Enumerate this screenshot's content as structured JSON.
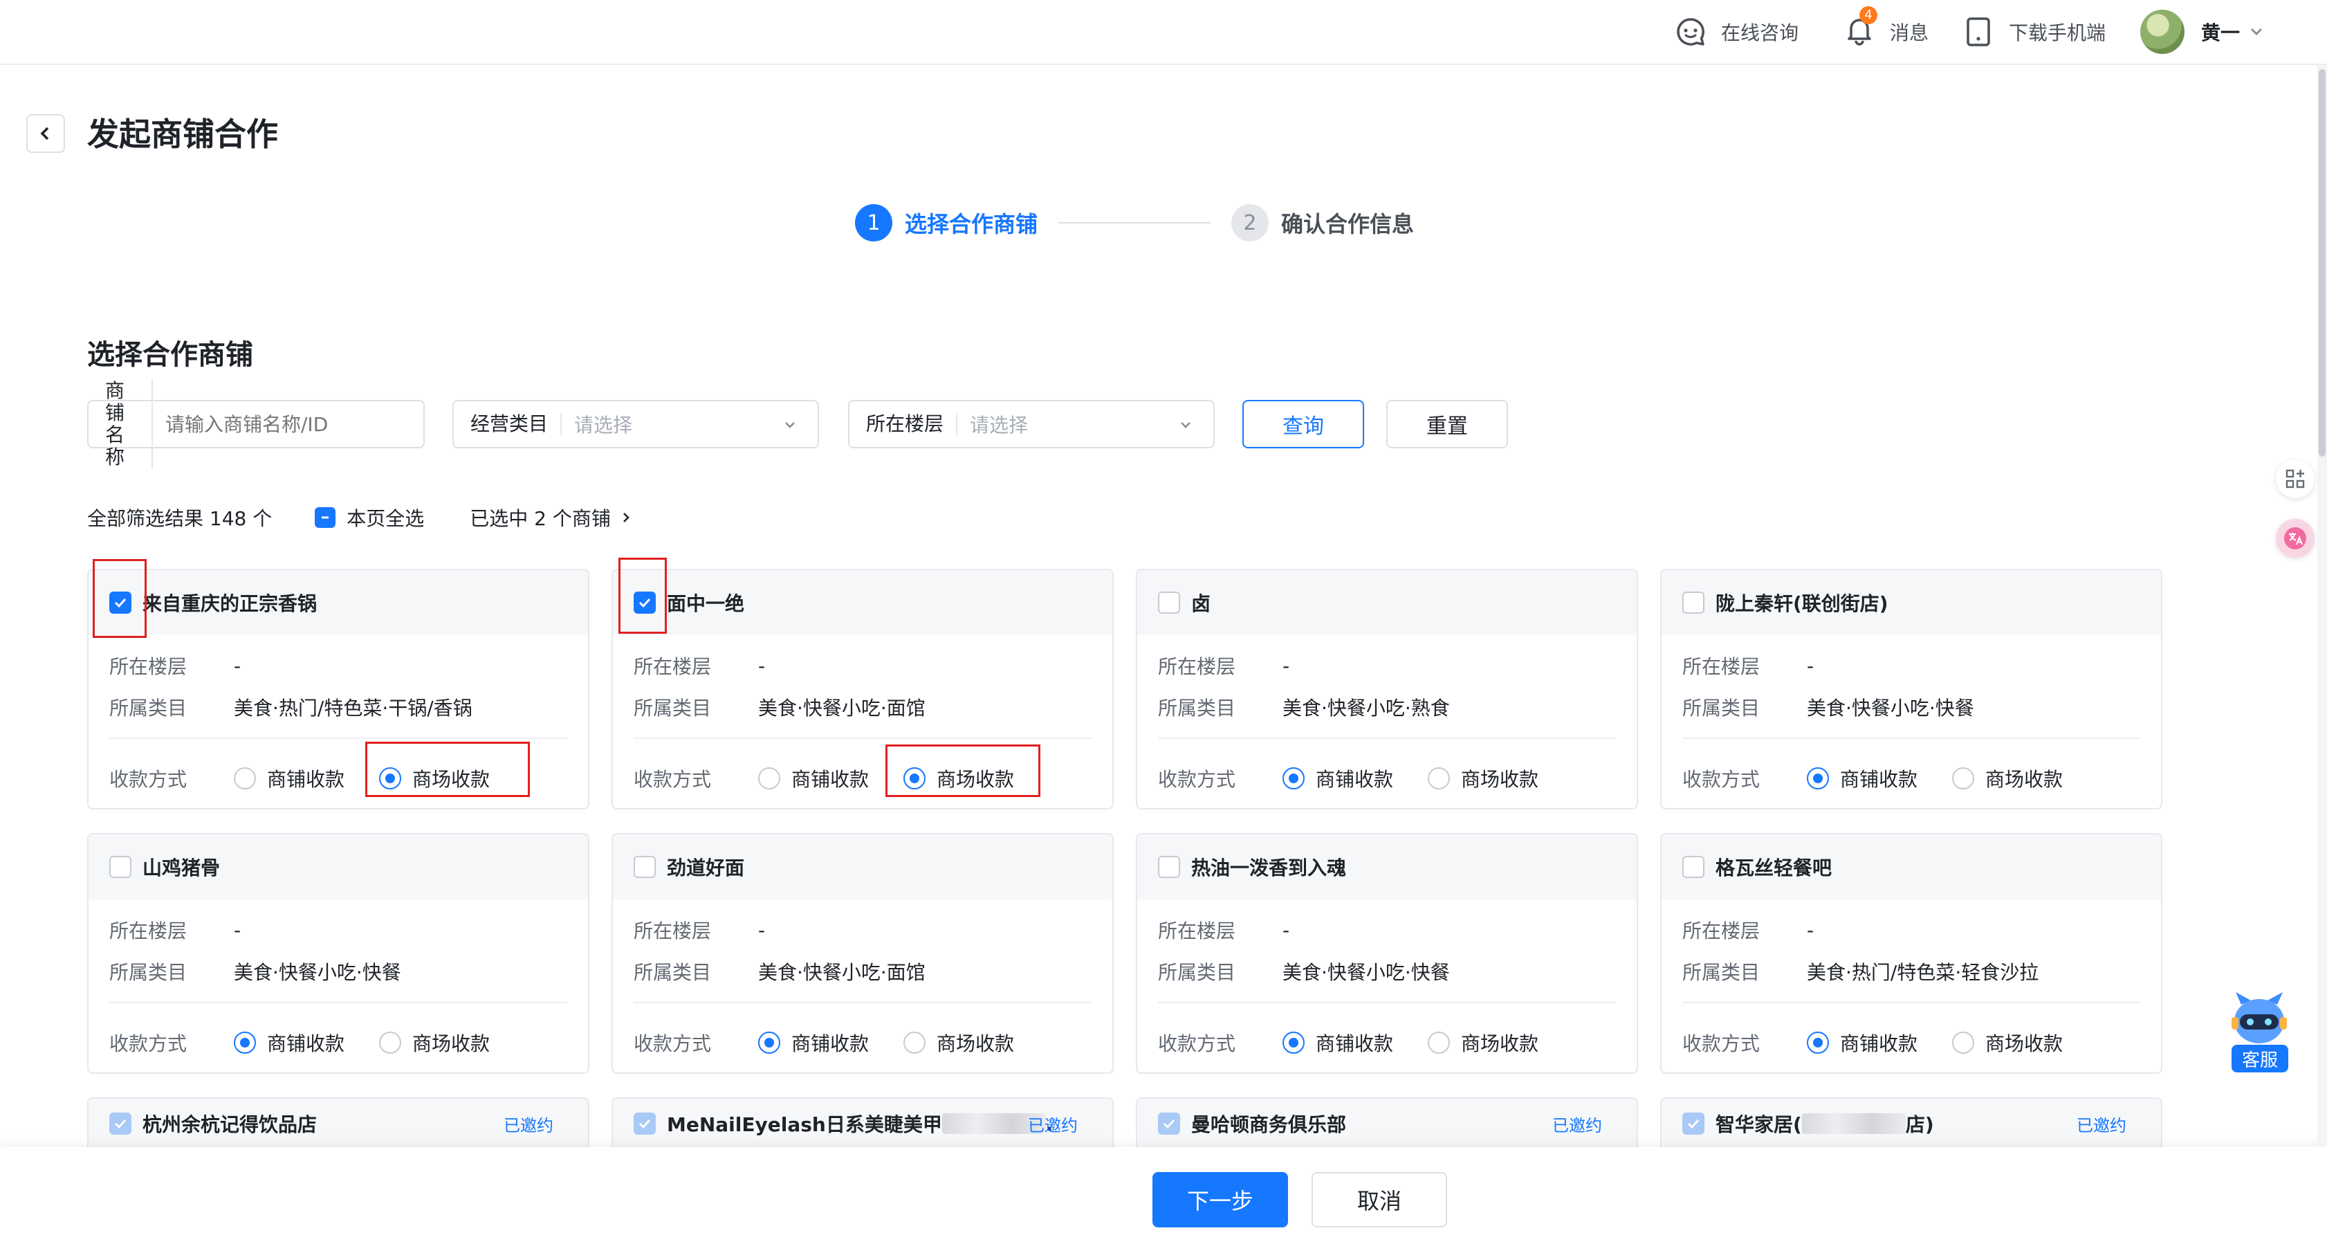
{
  "topbar": {
    "consult": "在线咨询",
    "messages": "消息",
    "message_count": "4",
    "download": "下载手机端",
    "user": "黄一"
  },
  "header": {
    "title": "发起商铺合作"
  },
  "steps": [
    {
      "num": "1",
      "label": "选择合作商铺"
    },
    {
      "num": "2",
      "label": "确认合作信息"
    }
  ],
  "section": {
    "title": "选择合作商铺"
  },
  "filters": {
    "name_label": "商铺名称",
    "name_placeholder": "请输入商铺名称/ID",
    "category_label": "经营类目",
    "category_placeholder": "请选择",
    "floor_label": "所在楼层",
    "floor_placeholder": "请选择",
    "query": "查询",
    "reset": "重置"
  },
  "summary": {
    "total": "全部筛选结果 148 个",
    "select_page": "本页全选",
    "selected": "已选中 2 个商铺"
  },
  "labels": {
    "floor": "所在楼层",
    "category": "所属类目",
    "payment": "收款方式",
    "shop_pay": "商铺收款",
    "mall_pay": "商场收款",
    "invited": "已邀约"
  },
  "shops": [
    {
      "name": "来自重庆的正宗香锅",
      "floor": "-",
      "category": "美食·热门/特色菜·干锅/香锅",
      "checked": true,
      "payment": "mall"
    },
    {
      "name": "面中一绝",
      "floor": "-",
      "category": "美食·快餐小吃·面馆",
      "checked": true,
      "payment": "mall"
    },
    {
      "name": "卤",
      "floor": "-",
      "category": "美食·快餐小吃·熟食",
      "checked": false,
      "payment": "shop"
    },
    {
      "name": "陇上秦轩(联创街店)",
      "floor": "-",
      "category": "美食·快餐小吃·快餐",
      "checked": false,
      "payment": "shop"
    },
    {
      "name": "山鸡猪骨",
      "floor": "-",
      "category": "美食·快餐小吃·快餐",
      "checked": false,
      "payment": "shop"
    },
    {
      "name": "劲道好面",
      "floor": "-",
      "category": "美食·快餐小吃·面馆",
      "checked": false,
      "payment": "shop"
    },
    {
      "name": "热油一泼香到入魂",
      "floor": "-",
      "category": "美食·快餐小吃·快餐",
      "checked": false,
      "payment": "shop"
    },
    {
      "name": "格瓦丝轻餐吧",
      "floor": "-",
      "category": "美食·热门/特色菜·轻食沙拉",
      "checked": false,
      "payment": "shop"
    }
  ],
  "invited_shops": [
    {
      "name": "杭州余杭记得饮品店",
      "name_tail": ""
    },
    {
      "name": "MeNailEyelash日系美睫美甲",
      "name_tail": "."
    },
    {
      "name": "曼哈顿商务俱乐部",
      "name_tail": ""
    },
    {
      "name": "智华家居(",
      "name_tail": "店)"
    }
  ],
  "footer": {
    "next": "下一步",
    "cancel": "取消"
  },
  "support": {
    "label": "客服"
  }
}
